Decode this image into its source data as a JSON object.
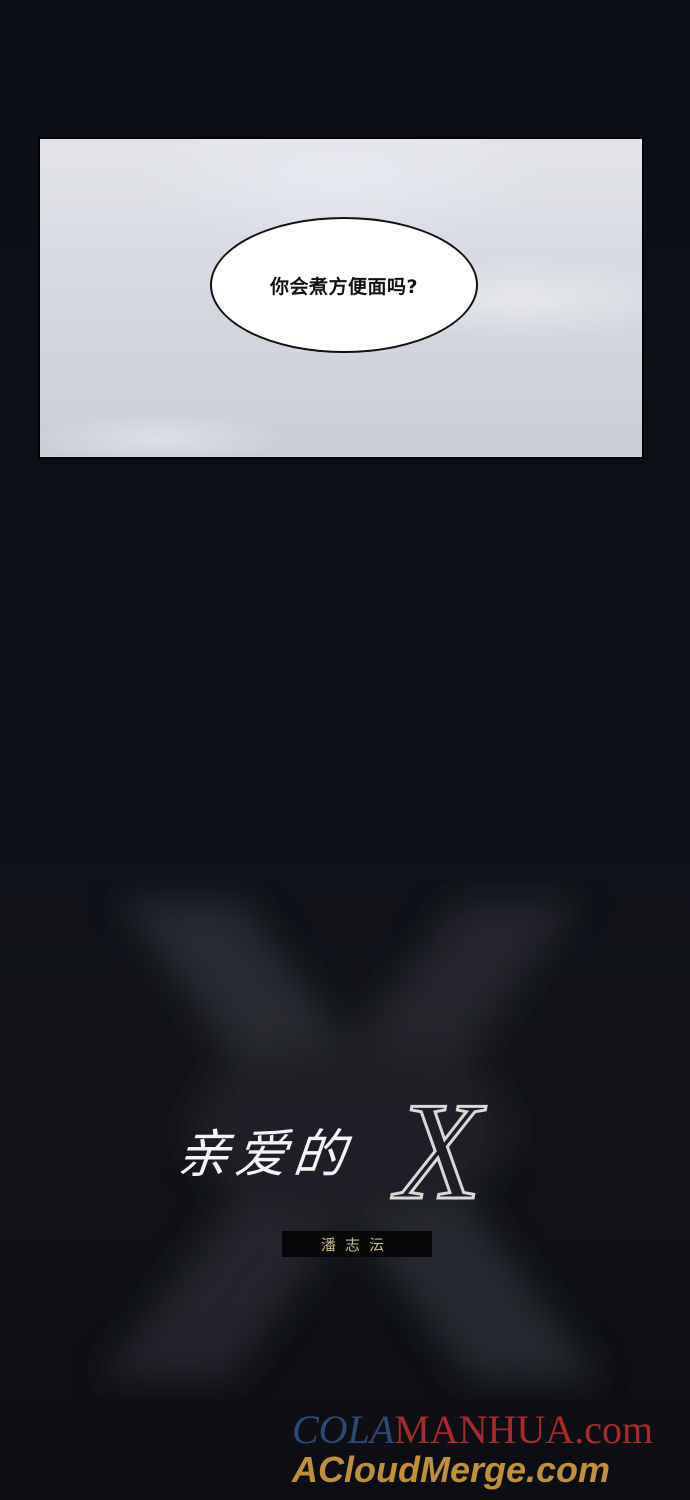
{
  "panel": {
    "speech": "你会煮方便面吗?"
  },
  "title": {
    "chinese": "亲爱的",
    "x": "X",
    "author": "潘志沄"
  },
  "watermark": {
    "line1_part1": "COLA",
    "line1_part2": "MANHUA.com",
    "line2": "ACloudMerge.com"
  }
}
